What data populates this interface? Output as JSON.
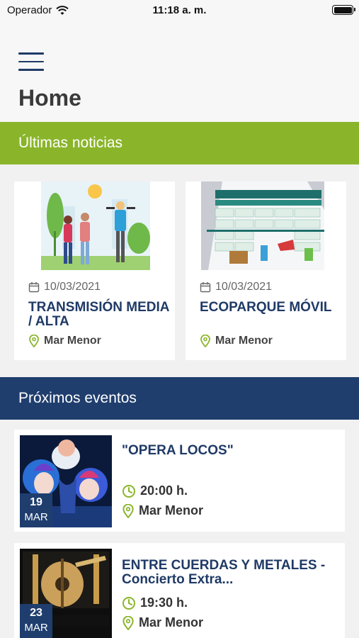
{
  "status": {
    "carrier": "Operador",
    "time": "11:18 a. m."
  },
  "header": {
    "title": "Home"
  },
  "news": {
    "section_title": "Últimas noticias",
    "items": [
      {
        "date": "10/03/2021",
        "title": "TRANSMISIÓN MEDIA / ALTA",
        "location": "Mar Menor"
      },
      {
        "date": "10/03/2021",
        "title": "ECOPARQUE MÓVIL",
        "location": "Mar Menor"
      }
    ]
  },
  "events": {
    "section_title": "Próximos eventos",
    "items": [
      {
        "day": "19",
        "month": "MAR",
        "title": "\"OPERA LOCOS\"",
        "time": "20:00 h.",
        "location": "Mar Menor"
      },
      {
        "day": "23",
        "month": "MAR",
        "title": "ENTRE CUERDAS Y METALES - Concierto Extra...",
        "time": "19:30 h.",
        "location": "Mar Menor"
      }
    ]
  },
  "colors": {
    "news_bar": "#8ab52a",
    "events_bar": "#1f3e6e",
    "title_blue": "#1f3a66",
    "icon_green": "#8ab52a"
  }
}
